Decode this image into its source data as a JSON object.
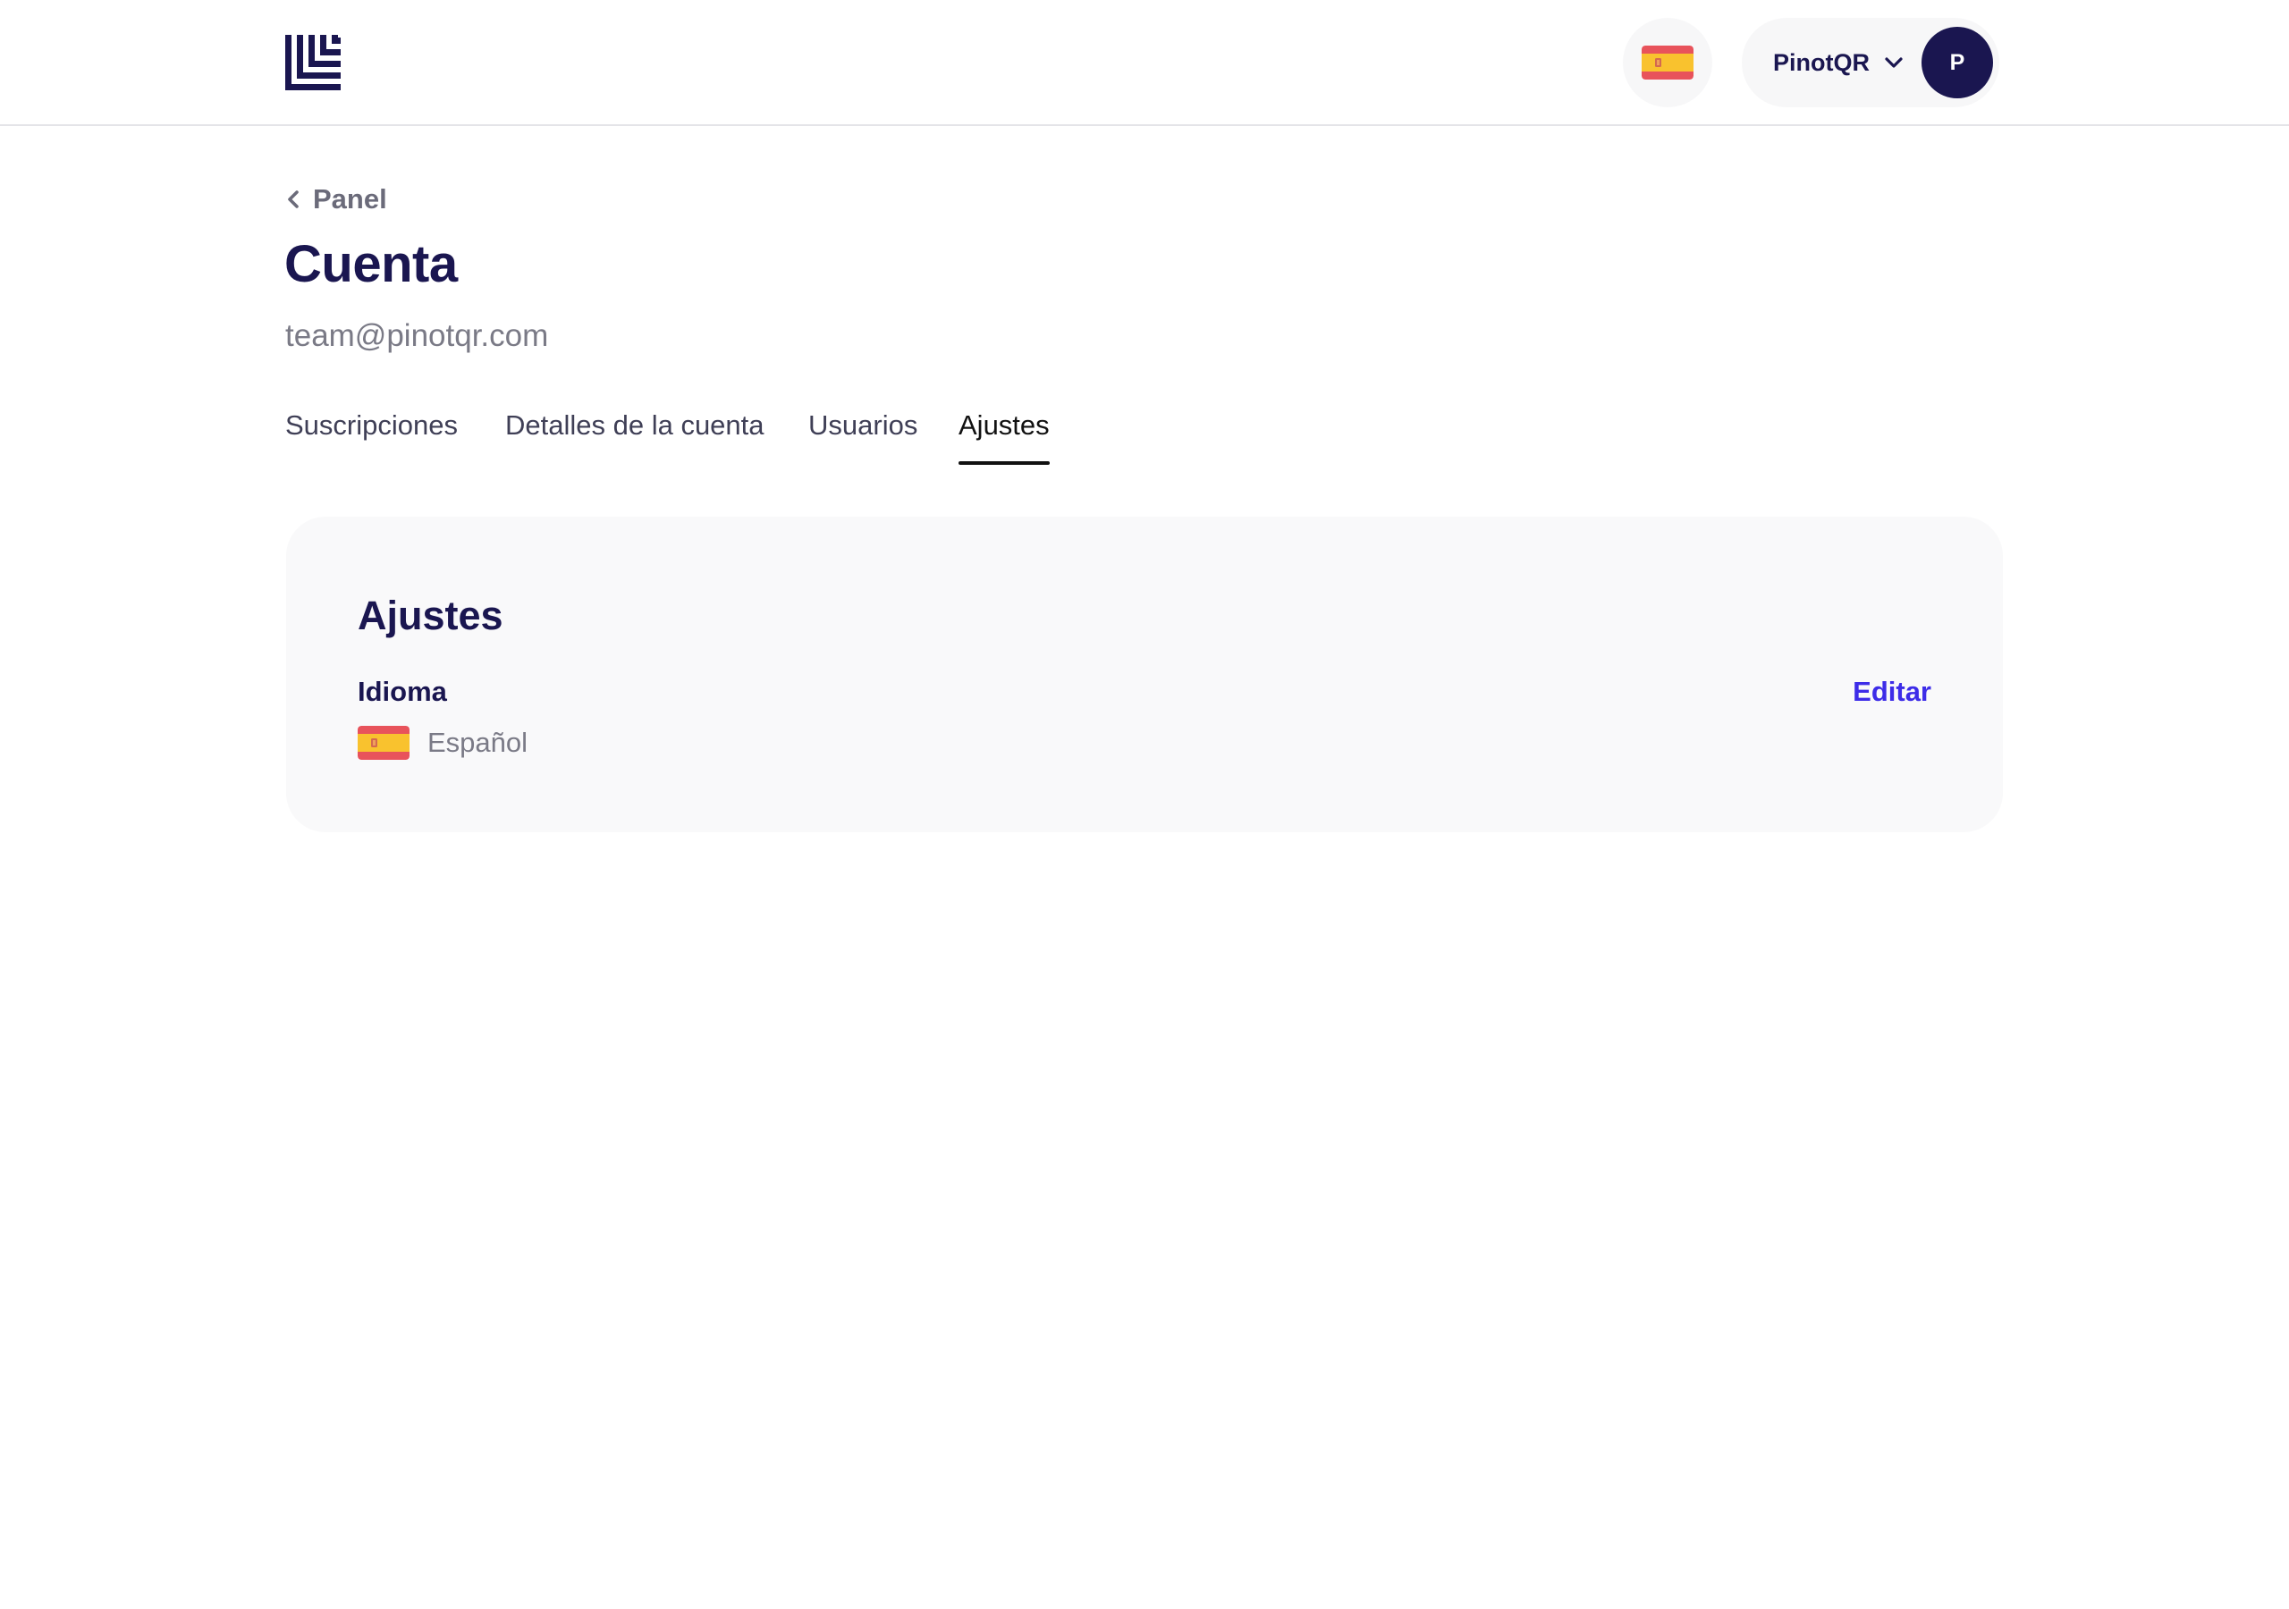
{
  "header": {
    "logo_icon": "stacked-corner-lines-logo",
    "language_flag_icon": "spain-flag-icon",
    "account_name": "PinotQR",
    "chevron_icon": "chevron-down-icon",
    "avatar_initial": "P"
  },
  "page": {
    "back_label": "Panel",
    "title": "Cuenta",
    "email": "team@pinotqr.com"
  },
  "tabs": [
    {
      "label": "Suscripciones",
      "active": false
    },
    {
      "label": "Detalles de la cuenta",
      "active": false
    },
    {
      "label": "Usuarios",
      "active": false
    },
    {
      "label": "Ajustes",
      "active": true
    }
  ],
  "settings": {
    "title": "Ajustes",
    "language_label": "Idioma",
    "edit_label": "Editar",
    "language_value": "Español",
    "language_flag_icon": "spain-flag-icon"
  },
  "colors": {
    "brand_navy": "#1a1650",
    "link_blue": "#3d2ce8",
    "muted_text": "#7a7a86",
    "card_background": "#f9f9fa",
    "flag_red": "#e8535b",
    "flag_yellow": "#f9c22e"
  }
}
